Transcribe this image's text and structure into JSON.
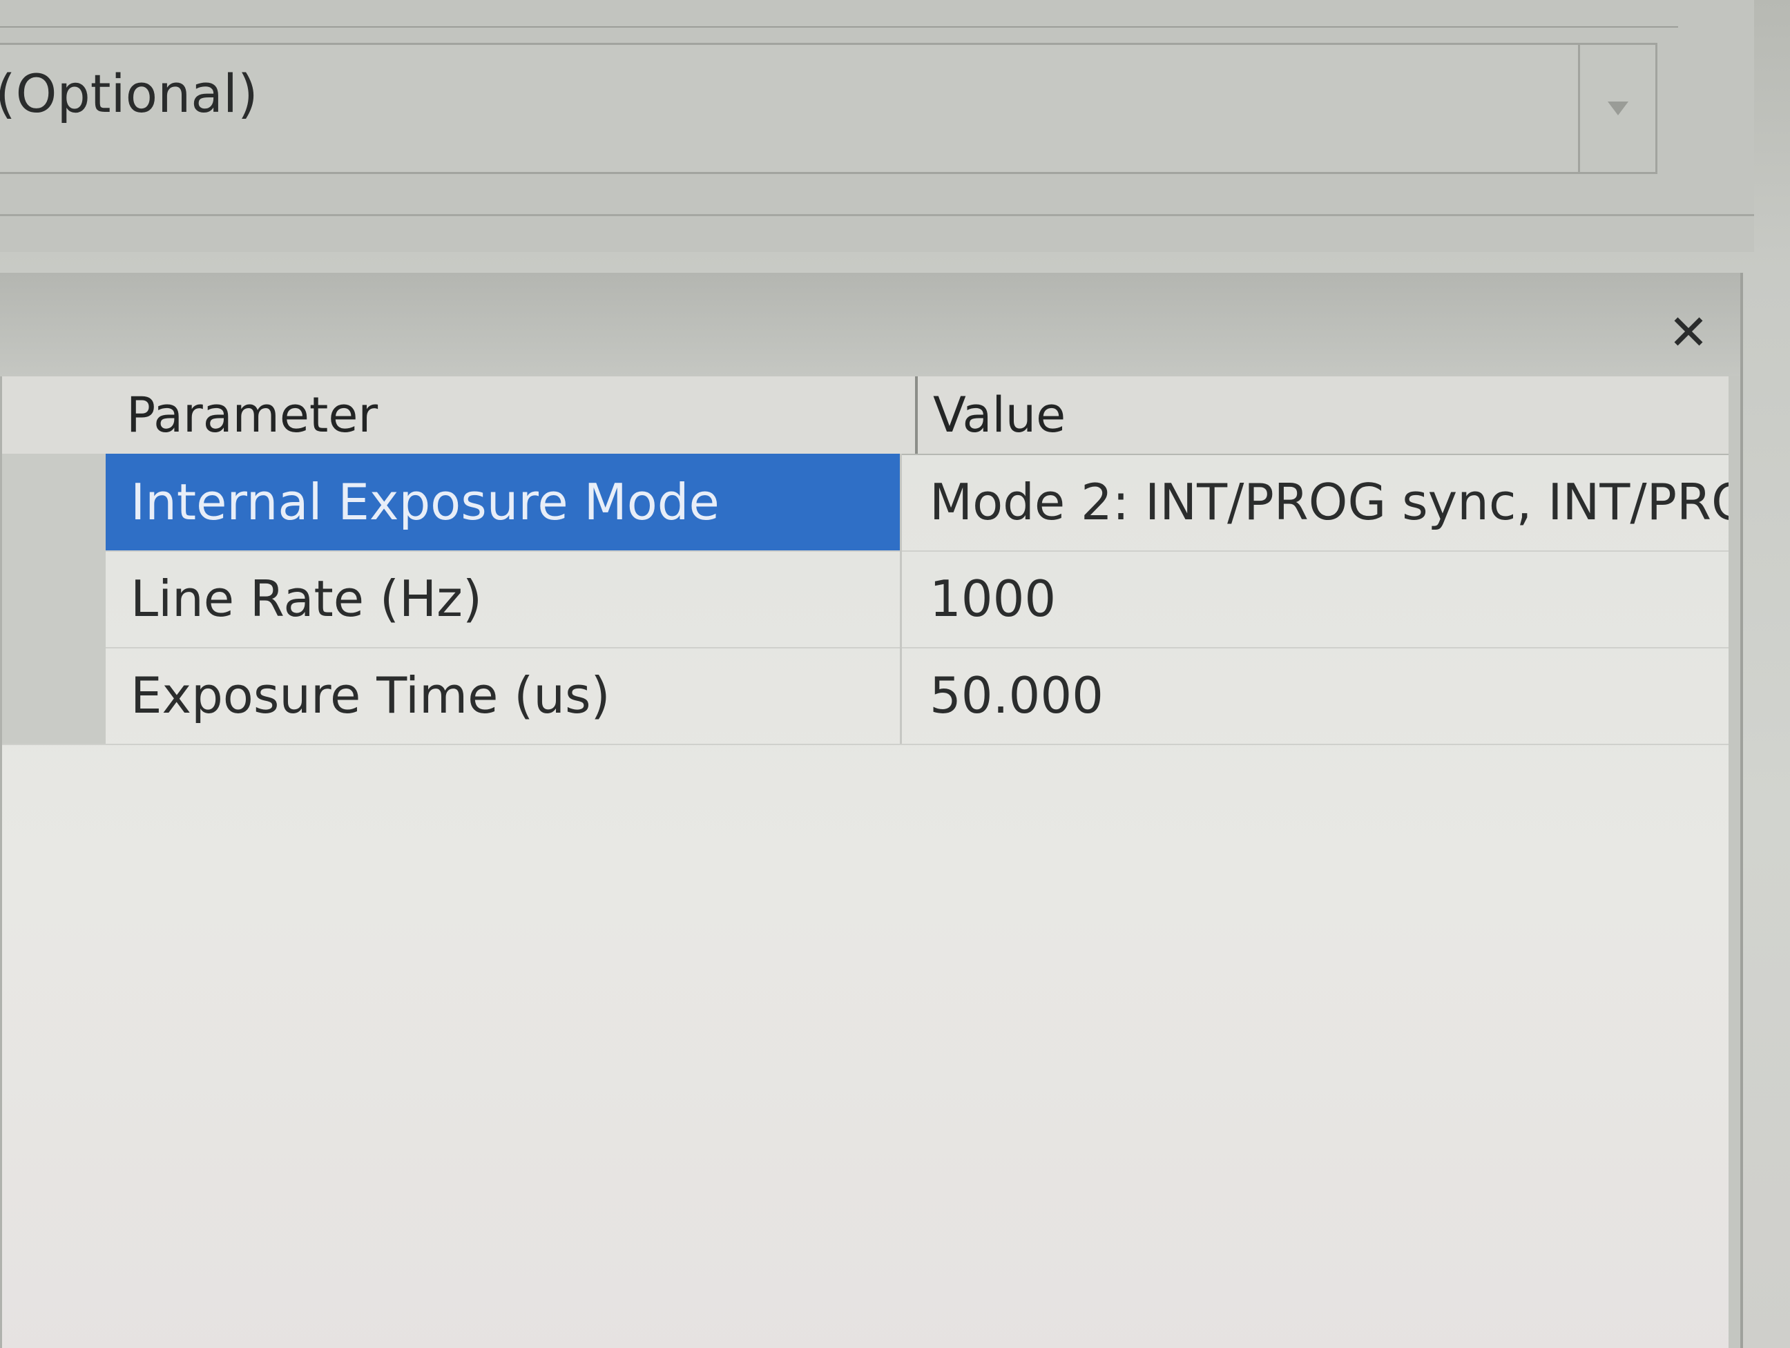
{
  "combo": {
    "text": "(Optional)"
  },
  "dialog": {
    "close_icon": "close-icon"
  },
  "grid": {
    "headers": {
      "parameter": "Parameter",
      "value": "Value"
    },
    "rows": [
      {
        "parameter": "Internal Exposure Mode",
        "value": "Mode 2: INT/PROG sync, INT/PRO...",
        "selected": true
      },
      {
        "parameter": "Line Rate (Hz)",
        "value": "1000",
        "selected": false
      },
      {
        "parameter": "Exposure Time (us)",
        "value": "50.000",
        "selected": false
      }
    ]
  },
  "colors": {
    "selection": "#2f6fc6"
  }
}
